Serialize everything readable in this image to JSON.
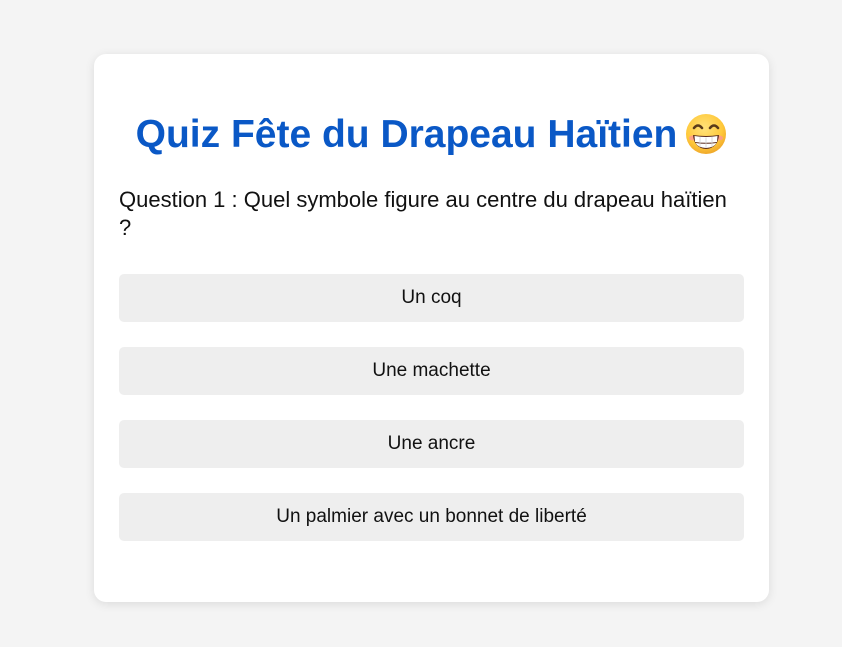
{
  "quiz": {
    "title": "Quiz Fête du Drapeau Haïtien",
    "title_emoji": "grinning-face-with-smiling-eyes-icon",
    "question": "Question 1 : Quel symbole figure au centre du drapeau haïtien ?",
    "answers": [
      {
        "label": "Un coq"
      },
      {
        "label": "Une machette"
      },
      {
        "label": "Une ancre"
      },
      {
        "label": "Un palmier avec un bonnet de liberté"
      }
    ]
  },
  "colors": {
    "page_background": "#f4f4f4",
    "card_background": "#ffffff",
    "title": "#0a58c6",
    "answer_background": "#eeeeee",
    "text": "#111111"
  }
}
